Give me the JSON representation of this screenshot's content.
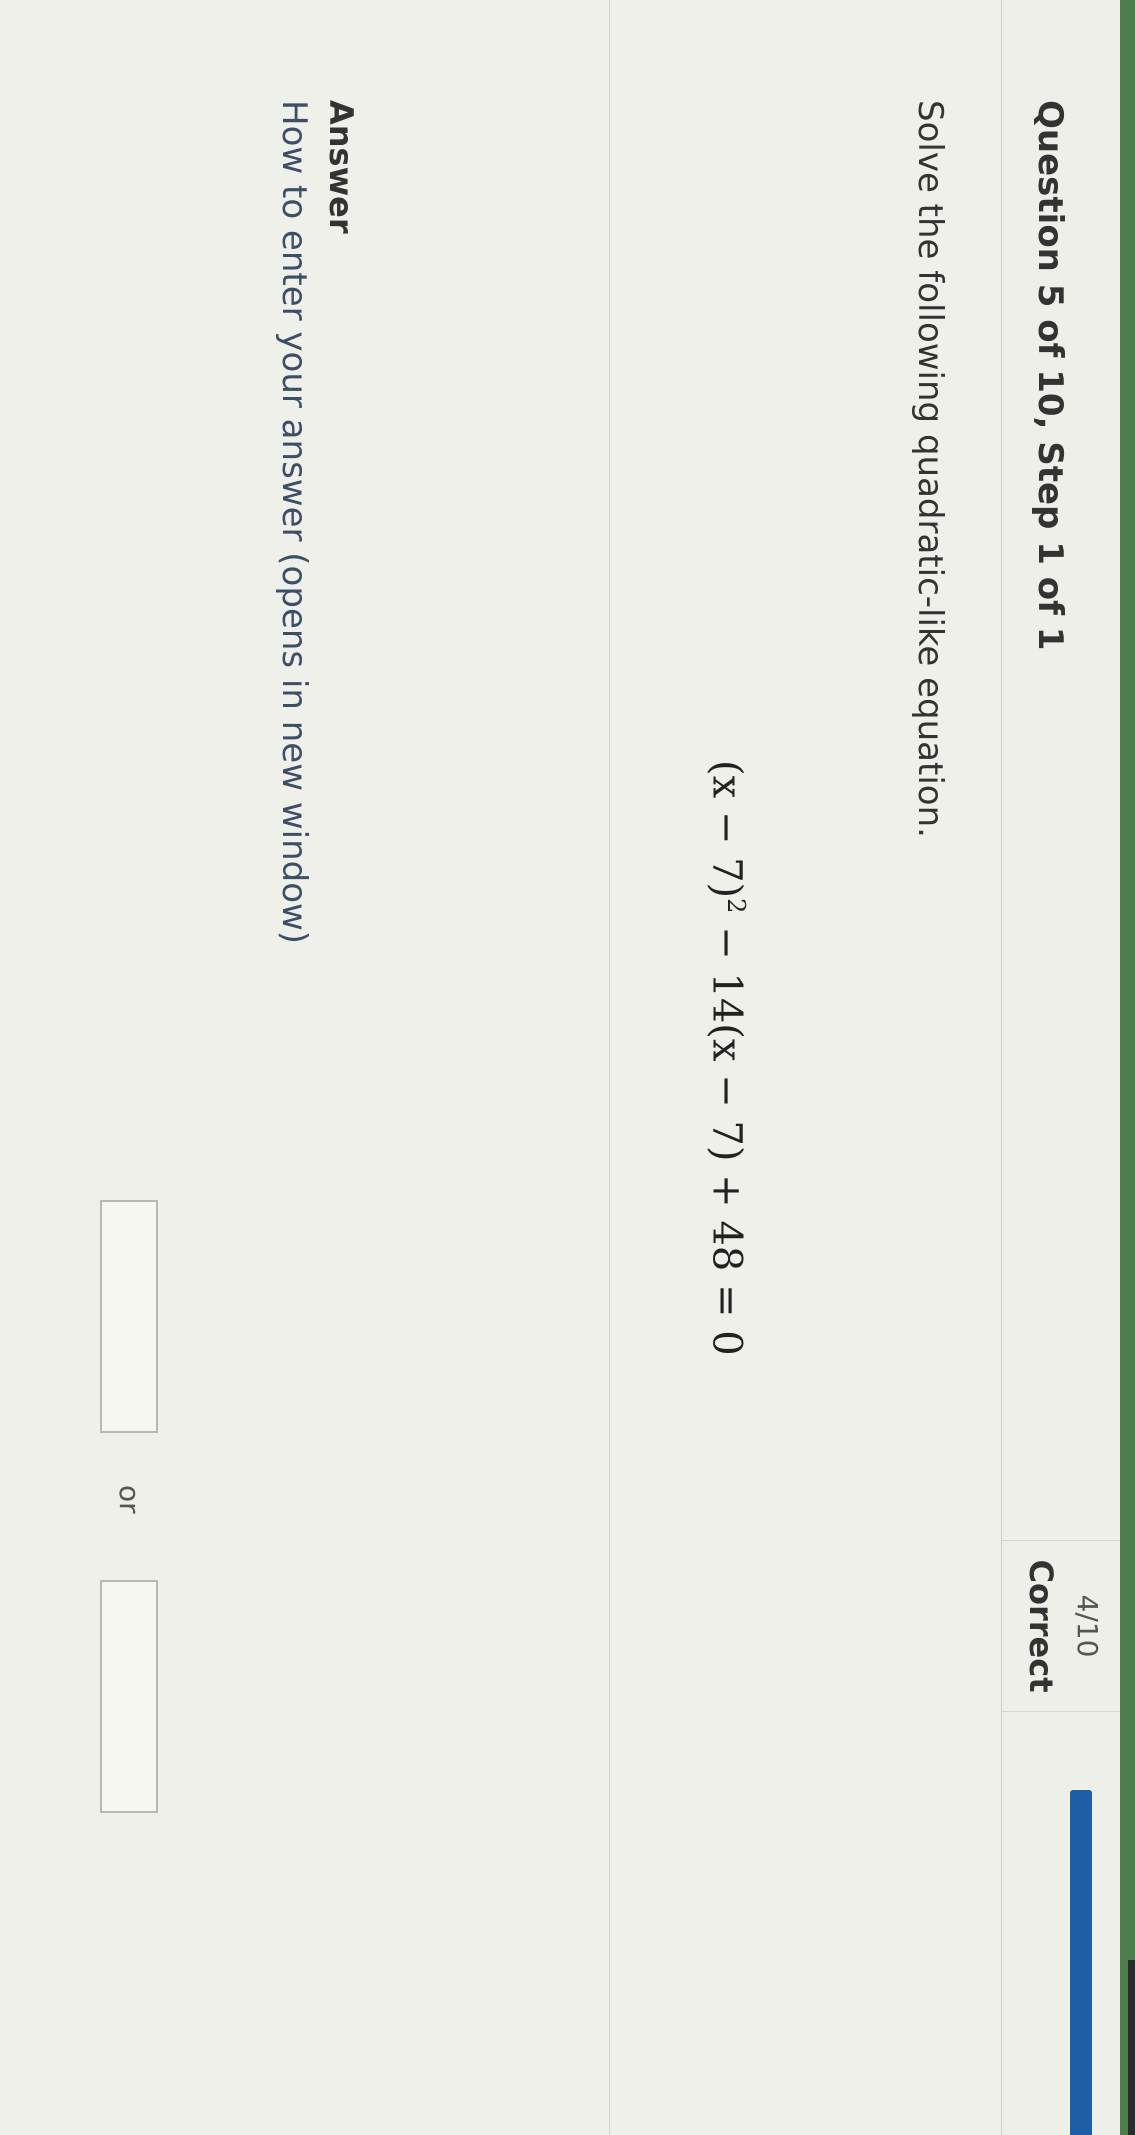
{
  "header": {
    "question_title": "Question 5 of 10, Step 1 of 1",
    "score_fraction": "4/10",
    "score_label": "Correct",
    "progress": 0.4
  },
  "question": {
    "prompt": "Solve the following quadratic-like equation.",
    "equation_part1": "(x − 7)",
    "equation_exp": "2",
    "equation_part2": " − 14(x − 7) + 48 = 0"
  },
  "answer": {
    "label": "Answer",
    "help_link": "How to enter your answer (opens in new window)",
    "or_text": "or",
    "input1_value": "",
    "input2_value": ""
  },
  "colors": {
    "progress_blue": "#1d5fa6",
    "page_green": "#4c7f4c"
  }
}
